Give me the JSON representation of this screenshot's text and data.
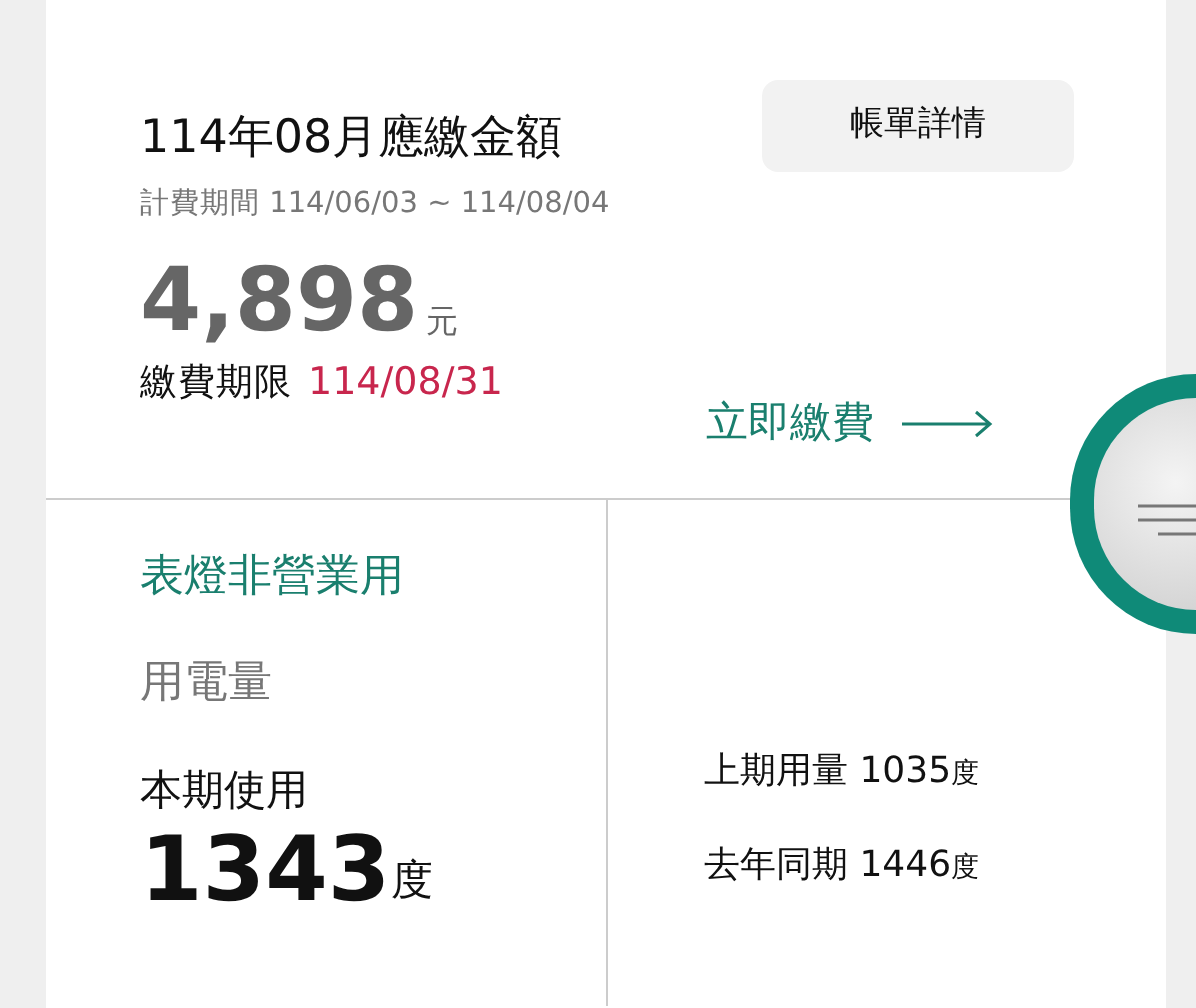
{
  "bill": {
    "title": "114年08月應繳金額",
    "details_button": "帳單詳情",
    "period": "計費期間 114/06/03 ~ 114/08/04",
    "amount": "4,898",
    "amount_unit": "元",
    "deadline_label": "繳費期限",
    "deadline": "114/08/31",
    "pay_link": "立即繳費"
  },
  "usage": {
    "rate_type": "表燈非營業用",
    "heading": "用電量",
    "current_label": "本期使用",
    "current_value": "1343",
    "current_unit": "度",
    "comparisons": [
      {
        "label": "上期用量",
        "value": "1035",
        "unit": "度"
      },
      {
        "label": "去年同期",
        "value": "1446",
        "unit": "度"
      }
    ]
  }
}
